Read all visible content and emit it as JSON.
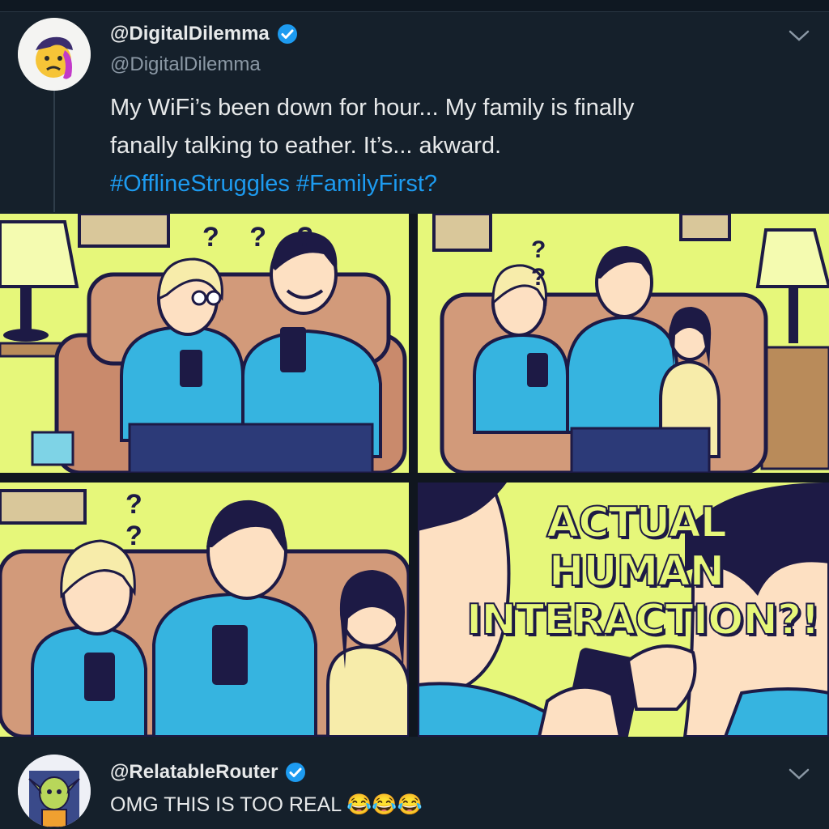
{
  "post": {
    "display_name": "@DigitalDilemma",
    "handle": "@DigitalDilemma",
    "text_line1": "My WiFi’s been down for hour... My family is finally",
    "text_line2": "fanally talking to eather. It’s... akward.",
    "hashtags": "#OfflineStruggles #FamilyFirst?",
    "verified": true
  },
  "comic": {
    "panel1_marks": "? ? ?",
    "panel2_marks": "? ?",
    "panel3_marks": "? ?",
    "caption_line1": "ACTUAL HUMAN",
    "caption_line2": "INTERACTION?!"
  },
  "reply": {
    "display_name": "@RelatableRouter",
    "text": "OMG THIS IS TOO REAL 😂😂😂",
    "verified": true
  },
  "colors": {
    "background": "#15202b",
    "link": "#1d9bf0",
    "comic_yellow": "#e6f77a",
    "shirt_blue": "#36b4e0",
    "ink": "#1d1a45"
  },
  "icons": {
    "verified": "verified-badge-icon",
    "more": "chevron-down-icon"
  }
}
